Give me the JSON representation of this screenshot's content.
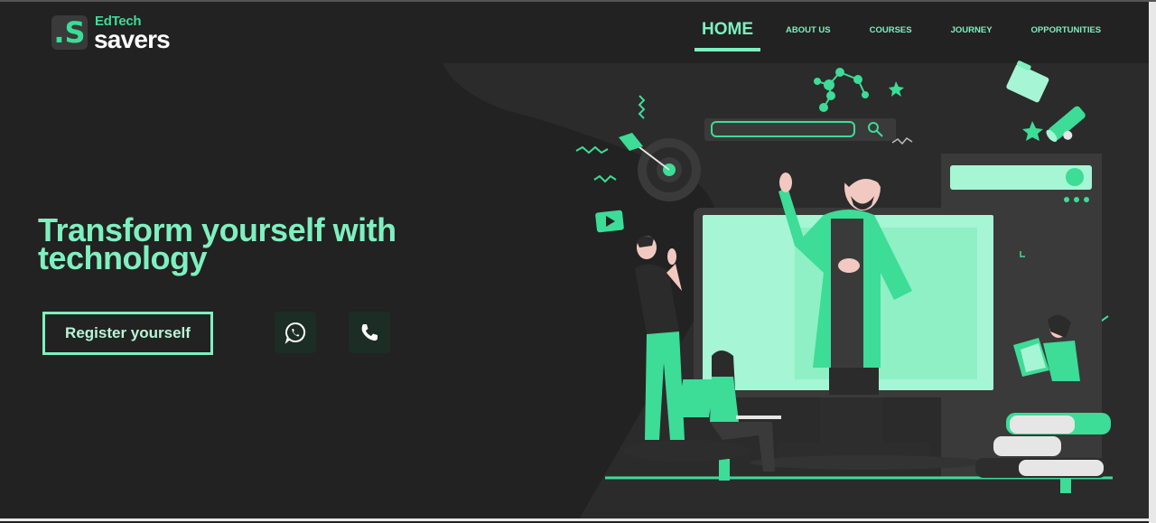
{
  "colors": {
    "background": "#222222",
    "accent": "#7ef0bf",
    "accent_strong": "#3ddc97",
    "illustration_screen": "#a6f5d4"
  },
  "brand": {
    "logo_mark": ".S",
    "name_top": "EdTech",
    "name_bottom": "savers"
  },
  "nav": {
    "items": [
      {
        "label": "HOME",
        "active": true
      },
      {
        "label": "ABOUT US",
        "active": false
      },
      {
        "label": "COURSES",
        "active": false
      },
      {
        "label": "JOURNEY",
        "active": false
      },
      {
        "label": "OPPORTUNITIES",
        "active": false
      }
    ]
  },
  "hero": {
    "headline_line1": "Transform yourself with",
    "headline_line2": "technology",
    "register_label": "Register yourself",
    "whatsapp_icon": "whatsapp-icon",
    "phone_icon": "phone-icon"
  }
}
